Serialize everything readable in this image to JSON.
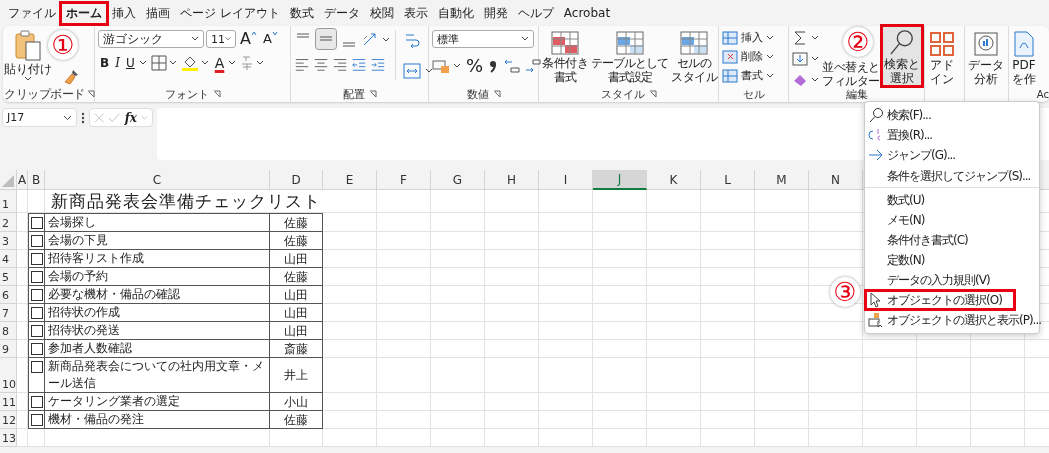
{
  "menu_tabs": [
    {
      "label": "ファイル",
      "selected": false,
      "annotated": false
    },
    {
      "label": "ホーム",
      "selected": true,
      "annotated": true
    },
    {
      "label": "挿入",
      "selected": false,
      "annotated": false
    },
    {
      "label": "描画",
      "selected": false,
      "annotated": false
    },
    {
      "label": "ページ レイアウト",
      "selected": false,
      "annotated": false
    },
    {
      "label": "数式",
      "selected": false,
      "annotated": false
    },
    {
      "label": "データ",
      "selected": false,
      "annotated": false
    },
    {
      "label": "校閲",
      "selected": false,
      "annotated": false
    },
    {
      "label": "表示",
      "selected": false,
      "annotated": false
    },
    {
      "label": "自動化",
      "selected": false,
      "annotated": false
    },
    {
      "label": "開発",
      "selected": false,
      "annotated": false
    },
    {
      "label": "ヘルプ",
      "selected": false,
      "annotated": false
    },
    {
      "label": "Acrobat",
      "selected": false,
      "annotated": false
    }
  ],
  "annotations": [
    {
      "number": "①"
    },
    {
      "number": "②"
    },
    {
      "number": "③"
    }
  ],
  "ribbon": {
    "clipboard": {
      "paste": "貼り付け",
      "label": "クリップボード"
    },
    "font": {
      "name": "游ゴシック",
      "size": "11",
      "grow": "A",
      "shrink": "A",
      "bold": "B",
      "italic": "I",
      "underline": "U",
      "color_letter": "A",
      "label": "フォント"
    },
    "alignment": {
      "label": "配置"
    },
    "number": {
      "format": "標準",
      "percent": "%",
      "label": "数値"
    },
    "styles": {
      "buttons": [
        [
          "条件付き",
          "書式"
        ],
        [
          "テーブルとして",
          "書式設定"
        ],
        [
          "セルの",
          "スタイル"
        ]
      ],
      "label": "スタイル"
    },
    "cells": {
      "buttons": [
        "挿入",
        "削除",
        "書式"
      ],
      "label": "セル"
    },
    "editing": {
      "sort_filter": [
        "並べ替えと",
        "フィルター"
      ],
      "find_select": {
        "label": [
          "検索と",
          "選択"
        ],
        "expanded": true,
        "annotated": true
      },
      "label": "編集"
    },
    "extra_buttons": [
      {
        "label": [
          "アド",
          "イン"
        ],
        "kind": "addin"
      },
      {
        "label": [
          "データ",
          "分析"
        ],
        "kind": "analysis"
      },
      {
        "label": [
          "PDF",
          "を作"
        ],
        "kind": "pdf"
      }
    ],
    "acrobat_label": "Ac"
  },
  "formula_bar": {
    "name_box": "J17",
    "function_label": "fx"
  },
  "sheet": {
    "columns": [
      {
        "label": "A",
        "selected": false
      },
      {
        "label": "B",
        "selected": false
      },
      {
        "label": "C",
        "selected": false
      },
      {
        "label": "D",
        "selected": false
      },
      {
        "label": "E",
        "selected": false
      },
      {
        "label": "F",
        "selected": false
      },
      {
        "label": "G",
        "selected": false
      },
      {
        "label": "H",
        "selected": false
      },
      {
        "label": "I",
        "selected": false
      },
      {
        "label": "J",
        "selected": true
      },
      {
        "label": "K",
        "selected": false
      },
      {
        "label": "L",
        "selected": false
      },
      {
        "label": "M",
        "selected": false
      },
      {
        "label": "N",
        "selected": false
      }
    ],
    "row_numbers": [
      "1",
      "2",
      "3",
      "4",
      "5",
      "6",
      "7",
      "8",
      "9",
      "10",
      "11",
      "12",
      "13"
    ],
    "title": "新商品発表会準備チェックリスト",
    "tasks": [
      {
        "checked": false,
        "task": "会場探し",
        "person": "佐藤"
      },
      {
        "checked": false,
        "task": "会場の下見",
        "person": "佐藤"
      },
      {
        "checked": false,
        "task": "招待客リスト作成",
        "person": "山田"
      },
      {
        "checked": false,
        "task": "会場の予約",
        "person": "佐藤"
      },
      {
        "checked": false,
        "task": "必要な機材・備品の確認",
        "person": "山田"
      },
      {
        "checked": false,
        "task": "招待状の作成",
        "person": "山田"
      },
      {
        "checked": false,
        "task": "招待状の発送",
        "person": "山田"
      },
      {
        "checked": false,
        "task": "参加者人数確認",
        "person": "斎藤"
      },
      {
        "checked": false,
        "task": "新商品発表会についての社内用文章・メール送信",
        "person": "井上"
      },
      {
        "checked": false,
        "task": "ケータリング業者の選定",
        "person": "小山"
      },
      {
        "checked": false,
        "task": "機材・備品の発注",
        "person": "佐藤"
      }
    ]
  },
  "dropdown": {
    "items": [
      {
        "label": "検索(F)...",
        "kind": "search",
        "separator_after": false,
        "annotated": false
      },
      {
        "label": "置換(R)...",
        "kind": "replace",
        "separator_after": false,
        "annotated": false
      },
      {
        "label": "ジャンプ(G)...",
        "kind": "jump",
        "separator_after": false,
        "annotated": false
      },
      {
        "label": "条件を選択してジャンプ(S)...",
        "kind": "plain",
        "separator_after": true,
        "annotated": false
      },
      {
        "label": "数式(U)",
        "kind": "plain",
        "separator_after": false,
        "annotated": false
      },
      {
        "label": "メモ(N)",
        "kind": "plain",
        "separator_after": false,
        "annotated": false
      },
      {
        "label": "条件付き書式(C)",
        "kind": "plain",
        "separator_after": false,
        "annotated": false
      },
      {
        "label": "定数(N)",
        "kind": "plain",
        "separator_after": false,
        "annotated": false
      },
      {
        "label": "データの入力規則(V)",
        "kind": "plain",
        "separator_after": false,
        "annotated": false
      },
      {
        "label": "オブジェクトの選択(O)",
        "kind": "cursor",
        "separator_after": false,
        "annotated": true
      },
      {
        "label": "オブジェクトの選択と表示(P)...",
        "kind": "pane",
        "separator_after": false,
        "annotated": false
      }
    ]
  }
}
